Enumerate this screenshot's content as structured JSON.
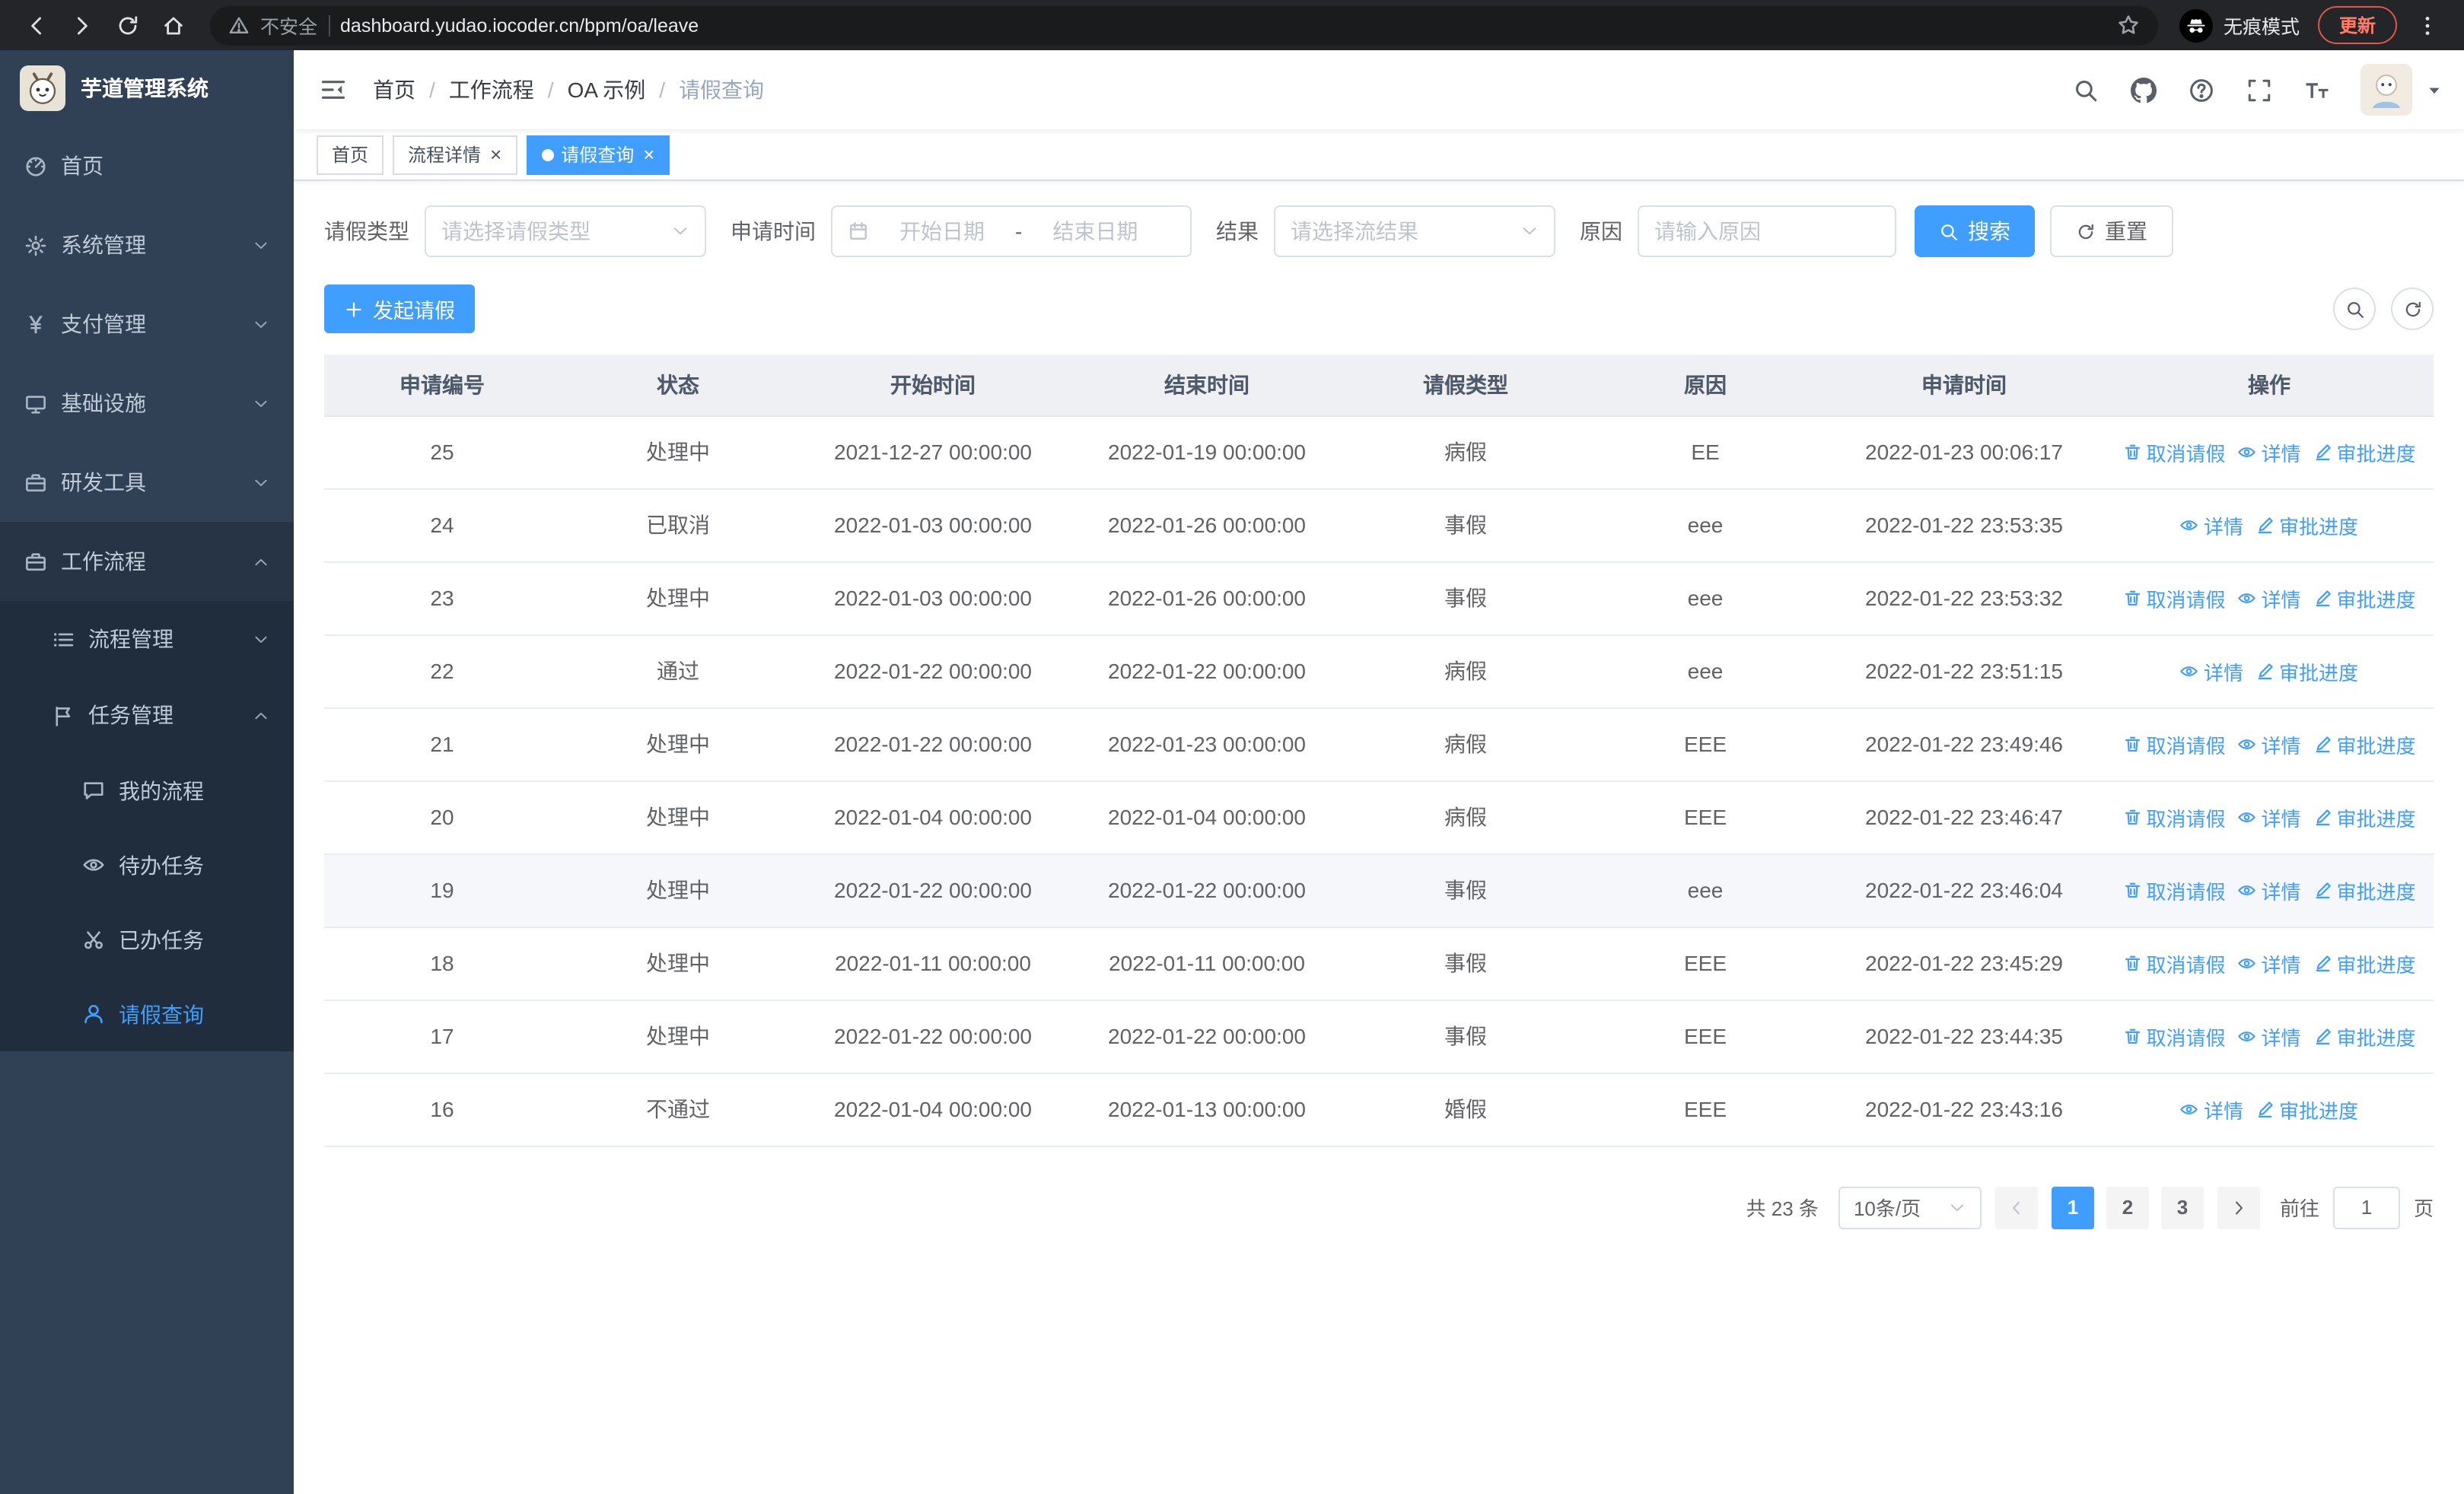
{
  "colors": {
    "primary": "#409EFF",
    "sidebar_bg": "#304156",
    "submenu_bg": "#1f2d3d",
    "update_red": "#ff7b69"
  },
  "browser": {
    "security_text": "不安全",
    "url": "dashboard.yudao.iocoder.cn/bpm/oa/leave",
    "incognito_label": "无痕模式",
    "update_label": "更新"
  },
  "sidebar": {
    "logo_title": "芋道管理系统",
    "items": [
      {
        "name": "home",
        "label": "首页",
        "icon": "dashboard",
        "arrow": null,
        "open": false
      },
      {
        "name": "system",
        "label": "系统管理",
        "icon": "gear",
        "arrow": "down",
        "open": false
      },
      {
        "name": "payment",
        "label": "支付管理",
        "icon": "yen",
        "arrow": "down",
        "open": false
      },
      {
        "name": "infrastructure",
        "label": "基础设施",
        "icon": "monitor",
        "arrow": "down",
        "open": false
      },
      {
        "name": "devtools",
        "label": "研发工具",
        "icon": "briefcase",
        "arrow": "down",
        "open": false
      },
      {
        "name": "workflow",
        "label": "工作流程",
        "icon": "briefcase",
        "arrow": "up",
        "open": true
      }
    ],
    "workflow_children": [
      {
        "name": "process-mgmt",
        "label": "流程管理",
        "icon": "list",
        "arrow": "down"
      },
      {
        "name": "task-mgmt",
        "label": "任务管理",
        "icon": "flag",
        "arrow": "up"
      }
    ],
    "task_children": [
      {
        "name": "my-process",
        "label": "我的流程",
        "icon": "chat",
        "active": false
      },
      {
        "name": "todo-tasks",
        "label": "待办任务",
        "icon": "eye",
        "active": false
      },
      {
        "name": "done-tasks",
        "label": "已办任务",
        "icon": "scissors",
        "active": false
      },
      {
        "name": "leave-query",
        "label": "请假查询",
        "icon": "user",
        "active": true
      }
    ]
  },
  "header": {
    "breadcrumb": [
      "首页",
      "工作流程",
      "OA 示例",
      "请假查询"
    ]
  },
  "tabs": [
    {
      "name": "home",
      "label": "首页",
      "closable": false,
      "active": false
    },
    {
      "name": "process-detail",
      "label": "流程详情",
      "closable": true,
      "active": false
    },
    {
      "name": "leave-query",
      "label": "请假查询",
      "closable": true,
      "active": true
    }
  ],
  "filters": {
    "leave_type_label": "请假类型",
    "leave_type_placeholder": "请选择请假类型",
    "apply_time_label": "申请时间",
    "date_start_placeholder": "开始日期",
    "date_separator": "-",
    "date_end_placeholder": "结束日期",
    "result_label": "结果",
    "result_placeholder": "请选择流结果",
    "reason_label": "原因",
    "reason_placeholder": "请输入原因",
    "search_label": "搜索",
    "reset_label": "重置"
  },
  "toolbar": {
    "create_label": "发起请假"
  },
  "table": {
    "columns": [
      "申请编号",
      "状态",
      "开始时间",
      "结束时间",
      "请假类型",
      "原因",
      "申请时间",
      "操作"
    ],
    "actions": {
      "cancel": "取消请假",
      "detail": "详情",
      "progress": "审批进度"
    },
    "rows": [
      {
        "id": "25",
        "status": "处理中",
        "start": "2021-12-27 00:00:00",
        "end": "2022-01-19 00:00:00",
        "type": "病假",
        "reason": "EE",
        "apply": "2022-01-23 00:06:17",
        "can_cancel": true,
        "highlight": false
      },
      {
        "id": "24",
        "status": "已取消",
        "start": "2022-01-03 00:00:00",
        "end": "2022-01-26 00:00:00",
        "type": "事假",
        "reason": "eee",
        "apply": "2022-01-22 23:53:35",
        "can_cancel": false,
        "highlight": false
      },
      {
        "id": "23",
        "status": "处理中",
        "start": "2022-01-03 00:00:00",
        "end": "2022-01-26 00:00:00",
        "type": "事假",
        "reason": "eee",
        "apply": "2022-01-22 23:53:32",
        "can_cancel": true,
        "highlight": false
      },
      {
        "id": "22",
        "status": "通过",
        "start": "2022-01-22 00:00:00",
        "end": "2022-01-22 00:00:00",
        "type": "病假",
        "reason": "eee",
        "apply": "2022-01-22 23:51:15",
        "can_cancel": false,
        "highlight": false
      },
      {
        "id": "21",
        "status": "处理中",
        "start": "2022-01-22 00:00:00",
        "end": "2022-01-23 00:00:00",
        "type": "病假",
        "reason": "EEE",
        "apply": "2022-01-22 23:49:46",
        "can_cancel": true,
        "highlight": false
      },
      {
        "id": "20",
        "status": "处理中",
        "start": "2022-01-04 00:00:00",
        "end": "2022-01-04 00:00:00",
        "type": "病假",
        "reason": "EEE",
        "apply": "2022-01-22 23:46:47",
        "can_cancel": true,
        "highlight": false
      },
      {
        "id": "19",
        "status": "处理中",
        "start": "2022-01-22 00:00:00",
        "end": "2022-01-22 00:00:00",
        "type": "事假",
        "reason": "eee",
        "apply": "2022-01-22 23:46:04",
        "can_cancel": true,
        "highlight": true
      },
      {
        "id": "18",
        "status": "处理中",
        "start": "2022-01-11 00:00:00",
        "end": "2022-01-11 00:00:00",
        "type": "事假",
        "reason": "EEE",
        "apply": "2022-01-22 23:45:29",
        "can_cancel": true,
        "highlight": false
      },
      {
        "id": "17",
        "status": "处理中",
        "start": "2022-01-22 00:00:00",
        "end": "2022-01-22 00:00:00",
        "type": "事假",
        "reason": "EEE",
        "apply": "2022-01-22 23:44:35",
        "can_cancel": true,
        "highlight": false
      },
      {
        "id": "16",
        "status": "不通过",
        "start": "2022-01-04 00:00:00",
        "end": "2022-01-13 00:00:00",
        "type": "婚假",
        "reason": "EEE",
        "apply": "2022-01-22 23:43:16",
        "can_cancel": false,
        "highlight": false
      }
    ]
  },
  "pagination": {
    "total_text": "共 23 条",
    "page_size": "10条/页",
    "pages": [
      "1",
      "2",
      "3"
    ],
    "active_page": "1",
    "goto_label": "前往",
    "goto_value": "1",
    "goto_suffix": "页"
  }
}
